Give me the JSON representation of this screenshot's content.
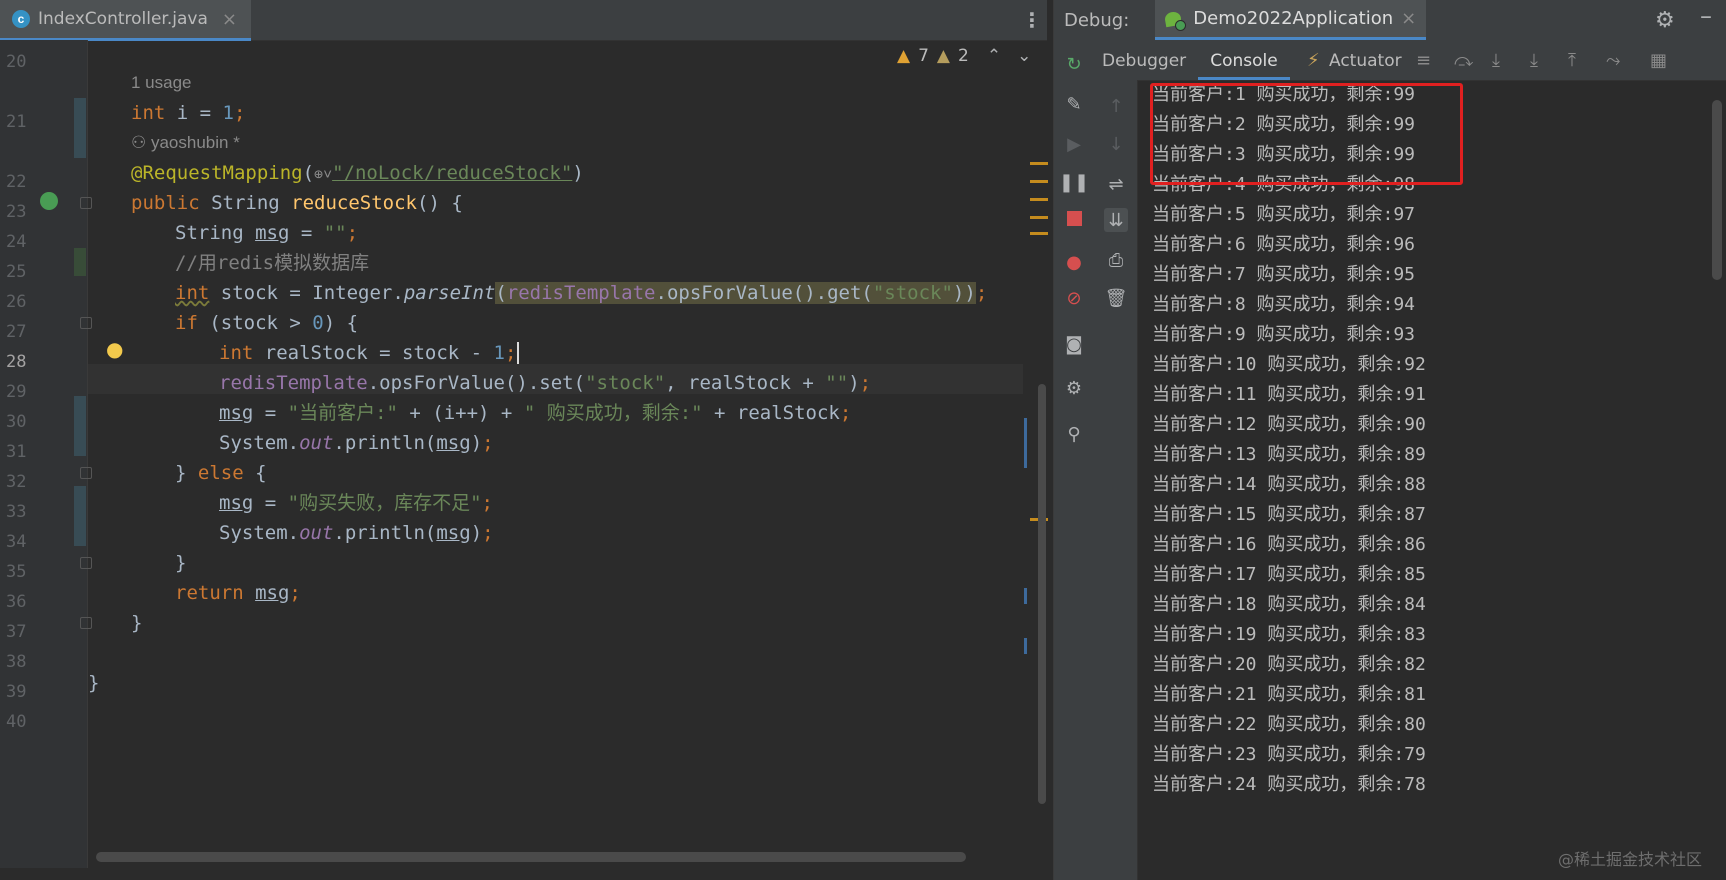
{
  "editor": {
    "file_tab": {
      "icon_letter": "c",
      "label": "IndexController.java"
    },
    "inspections": {
      "warnings": "7",
      "weak_warnings": "2"
    },
    "line_numbers": [
      "20",
      "21",
      "22",
      "23",
      "24",
      "25",
      "26",
      "27",
      "28",
      "29",
      "30",
      "31",
      "32",
      "33",
      "34",
      "35",
      "36",
      "37",
      "38",
      "39",
      "40"
    ],
    "hints": {
      "usage": "1 usage",
      "author": "yaoshubin *"
    },
    "code": {
      "l21_type": "int",
      "l21_rest": " i = ",
      "l21_num": "1",
      "l21_semi": ";",
      "l22_ann": "@RequestMapping",
      "l22_paren": "(",
      "l22_icons": "⊕˅",
      "l22_url": "\"/noLock/reduceStock\"",
      "l22_close": ")",
      "l23_kw": "public",
      "l23_type": " String ",
      "l23_fn": "reduceStock",
      "l23_rest": "() {",
      "l24_type": "String ",
      "l24_var": "msg",
      "l24_eq": " = ",
      "l24_str": "\"\"",
      "l24_semi": ";",
      "l25_cmt": "//用redis模拟数据库",
      "l26_type": "int",
      "l26_var": " stock",
      "l26_eq": " = Integer.",
      "l26_fn": "parseInt",
      "l26_open": "(",
      "l26_field": "redisTemplate",
      "l26_call": ".opsForValue().get(",
      "l26_str": "\"stock\"",
      "l26_close": "))",
      "l26_semi": ";",
      "l27_kw": "if",
      "l27_rest1": " (stock > ",
      "l27_num": "0",
      "l27_rest2": ") {",
      "l28_type": "int",
      "l28_rest": " realStock = stock - ",
      "l28_num": "1",
      "l28_semi": ";",
      "l29_field": "redisTemplate",
      "l29_call": ".opsForValue().set(",
      "l29_str1": "\"stock\"",
      "l29_mid": ", realStock + ",
      "l29_str2": "\"\"",
      "l29_close": ")",
      "l29_semi": ";",
      "l30_var": "msg",
      "l30_eq": " = ",
      "l30_str1": "\"当前客户:\"",
      "l30_mid1": " + (i++) + ",
      "l30_str2": "\" 购买成功，剩余:\"",
      "l30_mid2": " + realStock",
      "l30_semi": ";",
      "l31_sys": "System.",
      "l31_out": "out",
      "l31_call": ".println(",
      "l31_var": "msg",
      "l31_close": ")",
      "l31_semi": ";",
      "l32_close": "} ",
      "l32_kw": "else",
      "l32_open": " {",
      "l33_var": "msg",
      "l33_eq": " = ",
      "l33_str": "\"购买失败，库存不足\"",
      "l33_semi": ";",
      "l34_sys": "System.",
      "l34_out": "out",
      "l34_call": ".println(",
      "l34_var": "msg",
      "l34_close": ")",
      "l34_semi": ";",
      "l35": "}",
      "l36_kw": "return",
      "l36_sp": " ",
      "l36_var": "msg",
      "l36_semi": ";",
      "l37": "}",
      "l39": "}"
    }
  },
  "debug": {
    "label": "Debug:",
    "run_config": "Demo2022Application",
    "tabs": {
      "debugger": "Debugger",
      "console": "Console",
      "actuator": "Actuator"
    },
    "console_lines": [
      "当前客户:1 购买成功，剩余:99",
      "当前客户:2 购买成功，剩余:99",
      "当前客户:3 购买成功，剩余:99",
      "当前客户:4 购买成功，剩余:98",
      "当前客户:5 购买成功，剩余:97",
      "当前客户:6 购买成功，剩余:96",
      "当前客户:7 购买成功，剩余:95",
      "当前客户:8 购买成功，剩余:94",
      "当前客户:9 购买成功，剩余:93",
      "当前客户:10 购买成功，剩余:92",
      "当前客户:11 购买成功，剩余:91",
      "当前客户:12 购买成功，剩余:90",
      "当前客户:13 购买成功，剩余:89",
      "当前客户:14 购买成功，剩余:88",
      "当前客户:15 购买成功，剩余:87",
      "当前客户:16 购买成功，剩余:86",
      "当前客户:17 购买成功，剩余:85",
      "当前客户:18 购买成功，剩余:84",
      "当前客户:19 购买成功，剩余:83",
      "当前客户:20 购买成功，剩余:82",
      "当前客户:21 购买成功，剩余:81",
      "当前客户:22 购买成功，剩余:80",
      "当前客户:23 购买成功，剩余:79",
      "当前客户:24 购买成功，剩余:78"
    ]
  },
  "watermark": "@稀土掘金技术社区",
  "colors": {
    "accent": "#4a88c7",
    "highlight_box": "#e02020",
    "keyword": "#cc7832",
    "string": "#6a8759",
    "number": "#6897bb"
  }
}
